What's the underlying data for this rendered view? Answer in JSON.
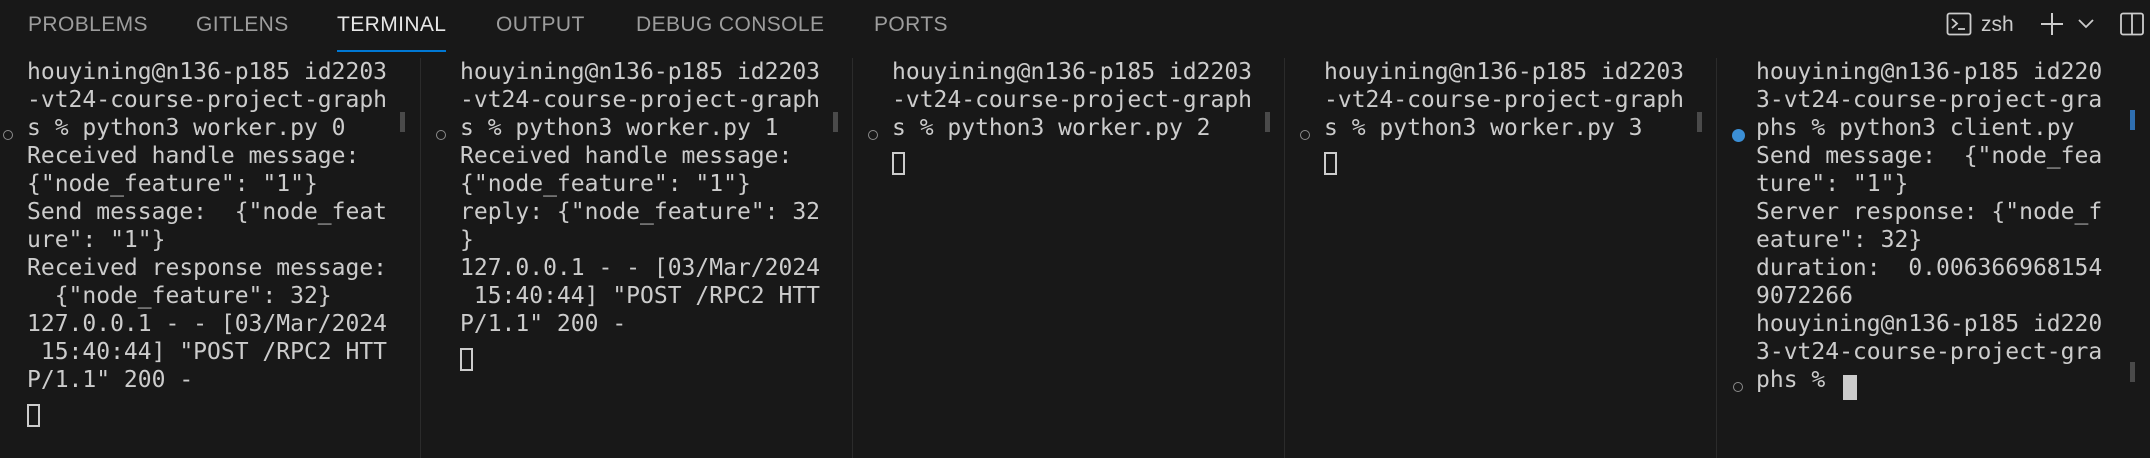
{
  "panel": {
    "tabs": [
      {
        "label": "PROBLEMS"
      },
      {
        "label": "GITLENS"
      },
      {
        "label": "TERMINAL"
      },
      {
        "label": "OUTPUT"
      },
      {
        "label": "DEBUG CONSOLE"
      },
      {
        "label": "PORTS"
      }
    ],
    "active_tab": "TERMINAL",
    "actions": {
      "shell_name": "zsh",
      "icons": [
        "terminal-icon",
        "plus-icon",
        "chevron-down-icon",
        "split-panel-icon"
      ]
    }
  },
  "terminals": [
    {
      "lines": [
        "houyining@n136-p185 id2203",
        "-vt24-course-project-graph",
        "s % python3 worker.py 0",
        "Received handle message:",
        "{\"node_feature\": \"1\"}",
        "Send message:  {\"node_feat",
        "ure\": \"1\"}",
        "Received response message:",
        "  {\"node_feature\": 32}",
        "127.0.0.1 - - [03/Mar/2024",
        " 15:40:44] \"POST /RPC2 HTT",
        "P/1.1\" 200 -"
      ]
    },
    {
      "lines": [
        "houyining@n136-p185 id2203",
        "-vt24-course-project-graph",
        "s % python3 worker.py 1",
        "Received handle message:",
        "{\"node_feature\": \"1\"}",
        "reply: {\"node_feature\": 32",
        "}",
        "127.0.0.1 - - [03/Mar/2024",
        " 15:40:44] \"POST /RPC2 HTT",
        "P/1.1\" 200 -"
      ]
    },
    {
      "lines": [
        "houyining@n136-p185 id2203",
        "-vt24-course-project-graph",
        "s % python3 worker.py 2"
      ]
    },
    {
      "lines": [
        "houyining@n136-p185 id2203",
        "-vt24-course-project-graph",
        "s % python3 worker.py 3"
      ]
    },
    {
      "lines": [
        "houyining@n136-p185 id220",
        "3-vt24-course-project-gra",
        "phs % python3 client.py",
        "Send message:  {\"node_fea",
        "ture\": \"1\"}",
        "Server response: {\"node_f",
        "eature\": 32}",
        "duration:  0.006366968154",
        "9072266",
        "houyining@n136-p185 id220",
        "3-vt24-course-project-gra",
        "phs % "
      ]
    }
  ],
  "colors": {
    "background": "#181818",
    "active_tab_underline": "#0078d4",
    "terminal_text": "#cccccc",
    "success_decoration": "#3b8fd6"
  }
}
